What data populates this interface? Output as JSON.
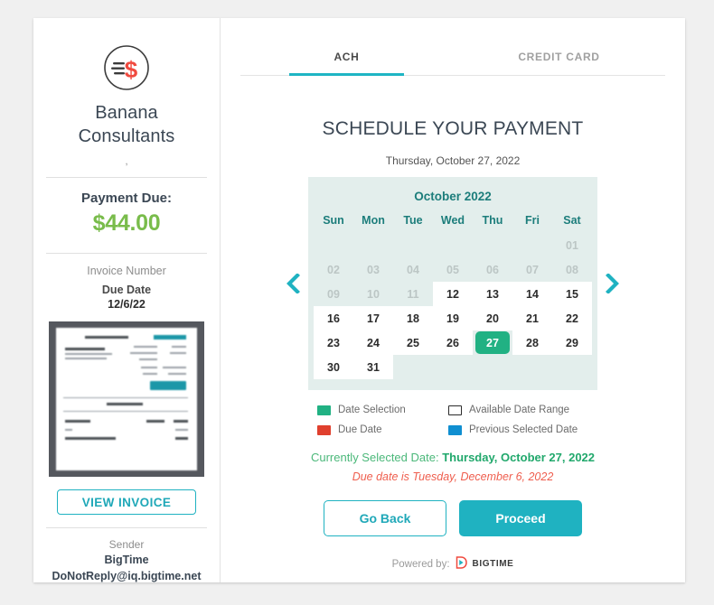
{
  "sidebar": {
    "logo_icon": "dollar-motion-icon",
    "company_name": "Banana Consultants",
    "company_sub": ",",
    "payment_due_label": "Payment Due:",
    "payment_amount": "$44.00",
    "invoice_number_label": "Invoice Number",
    "due_date_label": "Due Date",
    "due_date_value": "12/6/22",
    "invoice_thumb_name": "invoice-preview-thumbnail",
    "view_invoice_label": "VIEW INVOICE",
    "sender_label": "Sender",
    "sender_name": "BigTime",
    "sender_email": "DoNotReply@iq.bigtime.net"
  },
  "main": {
    "tabs": [
      {
        "label": "ACH",
        "active": true
      },
      {
        "label": "CREDIT CARD",
        "active": false
      }
    ],
    "title": "SCHEDULE YOUR PAYMENT",
    "today": "Thursday, October 27, 2022",
    "prev_arrow_icon": "chevron-left-icon",
    "next_arrow_icon": "chevron-right-icon",
    "legend": [
      {
        "label": "Date Selection",
        "swatch": "green",
        "color": "#21b183"
      },
      {
        "label": "Available Date Range",
        "swatch": "white",
        "color": "#ffffff"
      },
      {
        "label": "Due Date",
        "swatch": "red",
        "color": "#e0402e"
      },
      {
        "label": "Previous Selected Date",
        "swatch": "blue",
        "color": "#108fd1"
      }
    ],
    "selected_prefix": "Currently Selected Date: ",
    "selected_value": "Thursday, October 27, 2022",
    "due_note": "Due date is Tuesday, December 6, 2022",
    "go_back_label": "Go Back",
    "proceed_label": "Proceed",
    "powered_by_label": "Powered by:",
    "brand_name": "BIGTIME",
    "brand_icon": "bigtime-logo-icon"
  },
  "calendar": {
    "month_label": "October 2022",
    "day_headers": [
      "Sun",
      "Mon",
      "Tue",
      "Wed",
      "Thu",
      "Fri",
      "Sat"
    ],
    "weeks": [
      [
        {
          "label": "",
          "state": "blank"
        },
        {
          "label": "",
          "state": "blank"
        },
        {
          "label": "",
          "state": "blank"
        },
        {
          "label": "",
          "state": "blank"
        },
        {
          "label": "",
          "state": "blank"
        },
        {
          "label": "",
          "state": "blank"
        },
        {
          "label": "01",
          "state": "disabled"
        }
      ],
      [
        {
          "label": "02",
          "state": "disabled"
        },
        {
          "label": "03",
          "state": "disabled"
        },
        {
          "label": "04",
          "state": "disabled"
        },
        {
          "label": "05",
          "state": "disabled"
        },
        {
          "label": "06",
          "state": "disabled"
        },
        {
          "label": "07",
          "state": "disabled"
        },
        {
          "label": "08",
          "state": "disabled"
        }
      ],
      [
        {
          "label": "09",
          "state": "disabled"
        },
        {
          "label": "10",
          "state": "disabled"
        },
        {
          "label": "11",
          "state": "disabled"
        },
        {
          "label": "12",
          "state": "avail"
        },
        {
          "label": "13",
          "state": "avail"
        },
        {
          "label": "14",
          "state": "avail"
        },
        {
          "label": "15",
          "state": "avail"
        }
      ],
      [
        {
          "label": "16",
          "state": "avail"
        },
        {
          "label": "17",
          "state": "avail"
        },
        {
          "label": "18",
          "state": "avail"
        },
        {
          "label": "19",
          "state": "avail"
        },
        {
          "label": "20",
          "state": "avail"
        },
        {
          "label": "21",
          "state": "avail"
        },
        {
          "label": "22",
          "state": "avail"
        }
      ],
      [
        {
          "label": "23",
          "state": "avail"
        },
        {
          "label": "24",
          "state": "avail"
        },
        {
          "label": "25",
          "state": "avail"
        },
        {
          "label": "26",
          "state": "avail"
        },
        {
          "label": "27",
          "state": "selected"
        },
        {
          "label": "28",
          "state": "avail"
        },
        {
          "label": "29",
          "state": "avail"
        }
      ],
      [
        {
          "label": "30",
          "state": "avail"
        },
        {
          "label": "31",
          "state": "avail"
        },
        {
          "label": "",
          "state": "blank"
        },
        {
          "label": "",
          "state": "blank"
        },
        {
          "label": "",
          "state": "blank"
        },
        {
          "label": "",
          "state": "blank"
        },
        {
          "label": "",
          "state": "blank"
        }
      ]
    ]
  },
  "colors": {
    "accent_teal": "#1fb2c1",
    "selection_green": "#21b183",
    "amount_green": "#79bc4b",
    "due_red": "#ef5e4e",
    "calendar_bg": "#e3eeec",
    "month_text": "#1c7d7b"
  }
}
